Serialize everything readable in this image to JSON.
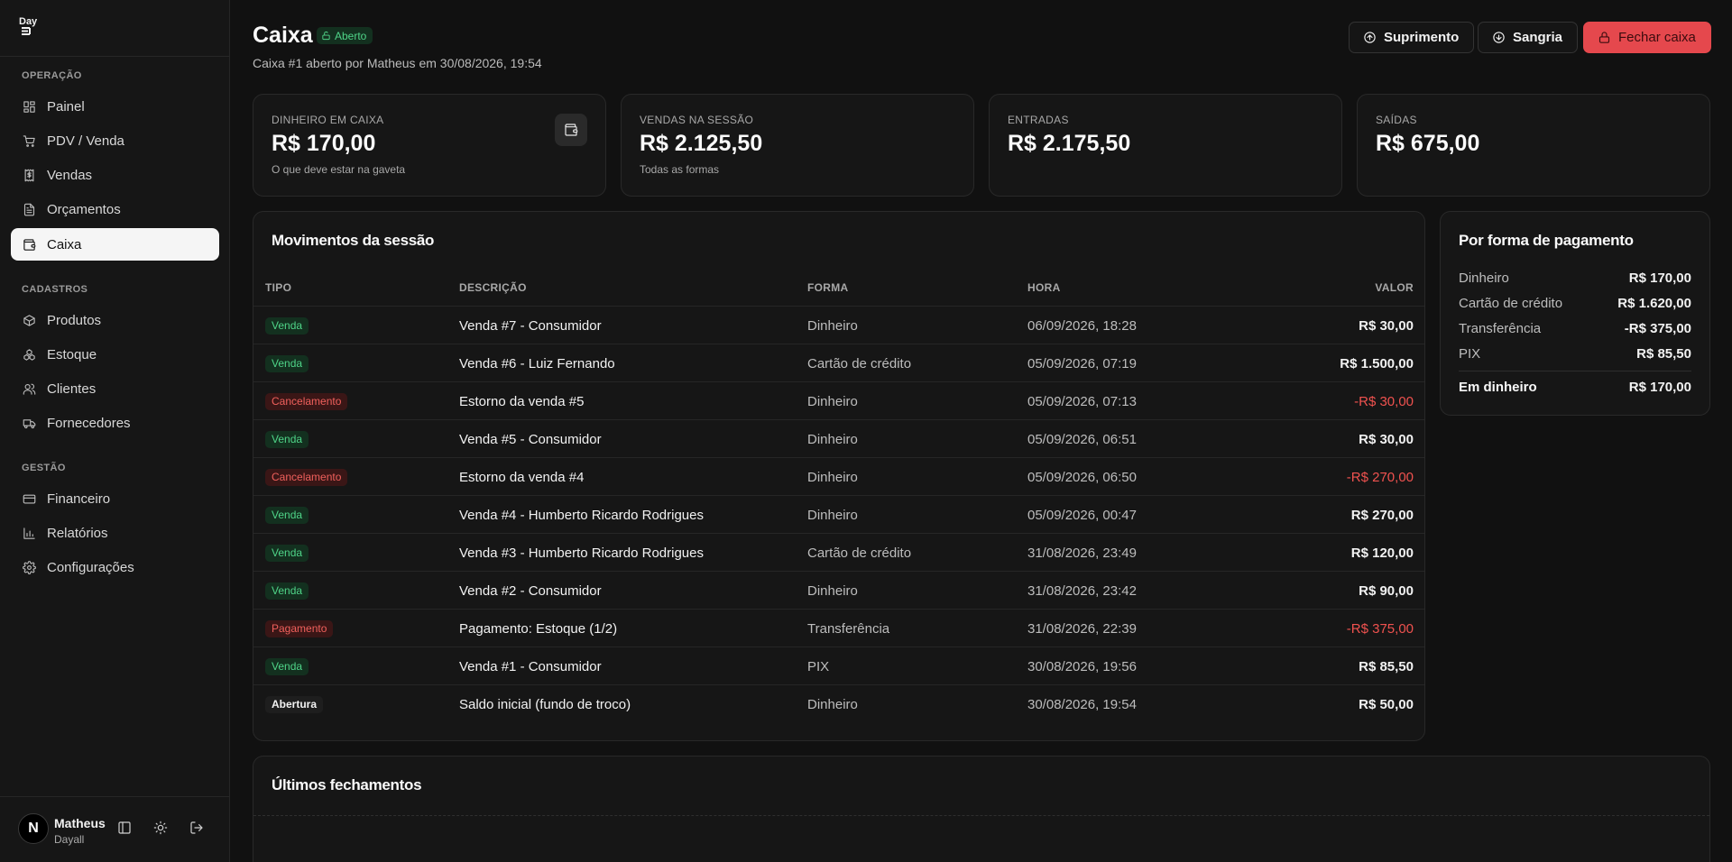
{
  "app": {
    "logo_text": "Day"
  },
  "sidebar": {
    "sections": [
      {
        "label": "OPERAÇÃO"
      },
      {
        "label": "CADASTROS"
      },
      {
        "label": "GESTÃO"
      }
    ],
    "items": [
      {
        "label": "Painel",
        "icon": "dashboard-icon"
      },
      {
        "label": "PDV / Venda",
        "icon": "cart-icon"
      },
      {
        "label": "Vendas",
        "icon": "receipt-icon"
      },
      {
        "label": "Orçamentos",
        "icon": "document-icon"
      },
      {
        "label": "Caixa",
        "icon": "wallet-icon",
        "active": true
      },
      {
        "label": "Produtos",
        "icon": "package-icon"
      },
      {
        "label": "Estoque",
        "icon": "boxes-icon"
      },
      {
        "label": "Clientes",
        "icon": "users-icon"
      },
      {
        "label": "Fornecedores",
        "icon": "truck-icon"
      },
      {
        "label": "Financeiro",
        "icon": "credit-card-icon"
      },
      {
        "label": "Relatórios",
        "icon": "bar-chart-icon"
      },
      {
        "label": "Configurações",
        "icon": "gear-icon"
      }
    ],
    "user": {
      "initial": "N",
      "name": "Matheus",
      "org": "Dayall"
    }
  },
  "header": {
    "title": "Caixa",
    "status_badge": "Aberto",
    "subtitle": "Caixa #1 aberto por Matheus em 30/08/2026, 19:54",
    "actions": {
      "suprimento": "Suprimento",
      "sangria": "Sangria",
      "fechar": "Fechar caixa"
    }
  },
  "stats": [
    {
      "label": "DINHEIRO EM CAIXA",
      "value": "R$ 170,00",
      "hint": "O que deve estar na gaveta"
    },
    {
      "label": "VENDAS NA SESSÃO",
      "value": "R$ 2.125,50",
      "hint": "Todas as formas"
    },
    {
      "label": "ENTRADAS",
      "value": "R$ 2.175,50"
    },
    {
      "label": "SAÍDAS",
      "value": "R$ 675,00"
    }
  ],
  "movements": {
    "title": "Movimentos da sessão",
    "columns": {
      "tipo": "TIPO",
      "descricao": "DESCRIÇÃO",
      "forma": "FORMA",
      "hora": "HORA",
      "valor": "VALOR"
    },
    "rows": [
      {
        "tipo": "Venda",
        "kind": "venda",
        "descricao": "Venda #7 - Consumidor",
        "forma": "Dinheiro",
        "hora": "06/09/2026, 18:28",
        "valor": "R$ 30,00"
      },
      {
        "tipo": "Venda",
        "kind": "venda",
        "descricao": "Venda #6 - Luiz Fernando",
        "forma": "Cartão de crédito",
        "hora": "05/09/2026, 07:19",
        "valor": "R$ 1.500,00"
      },
      {
        "tipo": "Cancelamento",
        "kind": "cancel",
        "descricao": "Estorno da venda #5",
        "forma": "Dinheiro",
        "hora": "05/09/2026, 07:13",
        "valor": "-R$ 30,00"
      },
      {
        "tipo": "Venda",
        "kind": "venda",
        "descricao": "Venda #5 - Consumidor",
        "forma": "Dinheiro",
        "hora": "05/09/2026, 06:51",
        "valor": "R$ 30,00"
      },
      {
        "tipo": "Cancelamento",
        "kind": "cancel",
        "descricao": "Estorno da venda #4",
        "forma": "Dinheiro",
        "hora": "05/09/2026, 06:50",
        "valor": "-R$ 270,00"
      },
      {
        "tipo": "Venda",
        "kind": "venda",
        "descricao": "Venda #4 - Humberto Ricardo Rodrigues",
        "forma": "Dinheiro",
        "hora": "05/09/2026, 00:47",
        "valor": "R$ 270,00"
      },
      {
        "tipo": "Venda",
        "kind": "venda",
        "descricao": "Venda #3 - Humberto Ricardo Rodrigues",
        "forma": "Cartão de crédito",
        "hora": "31/08/2026, 23:49",
        "valor": "R$ 120,00"
      },
      {
        "tipo": "Venda",
        "kind": "venda",
        "descricao": "Venda #2 - Consumidor",
        "forma": "Dinheiro",
        "hora": "31/08/2026, 23:42",
        "valor": "R$ 90,00"
      },
      {
        "tipo": "Pagamento",
        "kind": "pag",
        "descricao": "Pagamento: Estoque (1/2)",
        "forma": "Transferência",
        "hora": "31/08/2026, 22:39",
        "valor": "-R$ 375,00"
      },
      {
        "tipo": "Venda",
        "kind": "venda",
        "descricao": "Venda #1 - Consumidor",
        "forma": "PIX",
        "hora": "30/08/2026, 19:56",
        "valor": "R$ 85,50"
      },
      {
        "tipo": "Abertura",
        "kind": "abert",
        "descricao": "Saldo inicial (fundo de troco)",
        "forma": "Dinheiro",
        "hora": "30/08/2026, 19:54",
        "valor": "R$ 50,00"
      }
    ]
  },
  "payments": {
    "title": "Por forma de pagamento",
    "rows": [
      {
        "label": "Dinheiro",
        "value": "R$ 170,00"
      },
      {
        "label": "Cartão de crédito",
        "value": "R$ 1.620,00"
      },
      {
        "label": "Transferência",
        "value": "-R$ 375,00"
      },
      {
        "label": "PIX",
        "value": "R$ 85,50"
      }
    ],
    "total": {
      "label": "Em dinheiro",
      "value": "R$ 170,00"
    }
  },
  "closings": {
    "title": "Últimos fechamentos"
  },
  "colors": {
    "accent_green": "#4fd488",
    "danger": "#e5484d",
    "negative_text": "#f0524f",
    "background": "#111111"
  }
}
